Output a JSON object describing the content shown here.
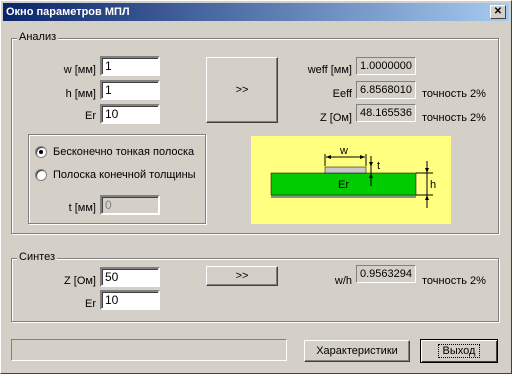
{
  "window": {
    "title": "Окно параметров МПЛ"
  },
  "analysis": {
    "group_label": "Анализ",
    "w_label": "w [мм]",
    "w_value": "1",
    "h_label": "h [мм]",
    "h_value": "1",
    "er_label": "Er",
    "er_value": "10",
    "compute_button": ">>",
    "weff_label": "weff [мм]",
    "weff_value": "1.0000000",
    "eeff_label": "Eeff",
    "eeff_value": "6.8568010",
    "eeff_accuracy": "точность 2%",
    "z_label": "Z [Ом]",
    "z_value": "48.165536",
    "z_accuracy": "точность 2%",
    "strip_options": {
      "infinitely_thin": "Бесконечно тонкая полоска",
      "finite_thickness": "Полоска конечной толщины",
      "selected": "infinitely_thin"
    },
    "t_label": "t [мм]",
    "t_value": "0",
    "diagram": {
      "w": "w",
      "t": "t",
      "er": "Er",
      "h": "h"
    }
  },
  "synthesis": {
    "group_label": "Синтез",
    "z_label": "Z [Ом]",
    "z_value": "50",
    "er_label": "Er",
    "er_value": "10",
    "compute_button": ">>",
    "wh_label": "w/h",
    "wh_value": "0.9563294",
    "accuracy": "точность 2%"
  },
  "footer": {
    "characteristics_button": "Характеристики",
    "exit_button": "Выход"
  },
  "colors": {
    "title_start": "#0a246a",
    "title_end": "#a6caf0",
    "diagram_bg": "#ffff80",
    "substrate": "#00cc00"
  }
}
